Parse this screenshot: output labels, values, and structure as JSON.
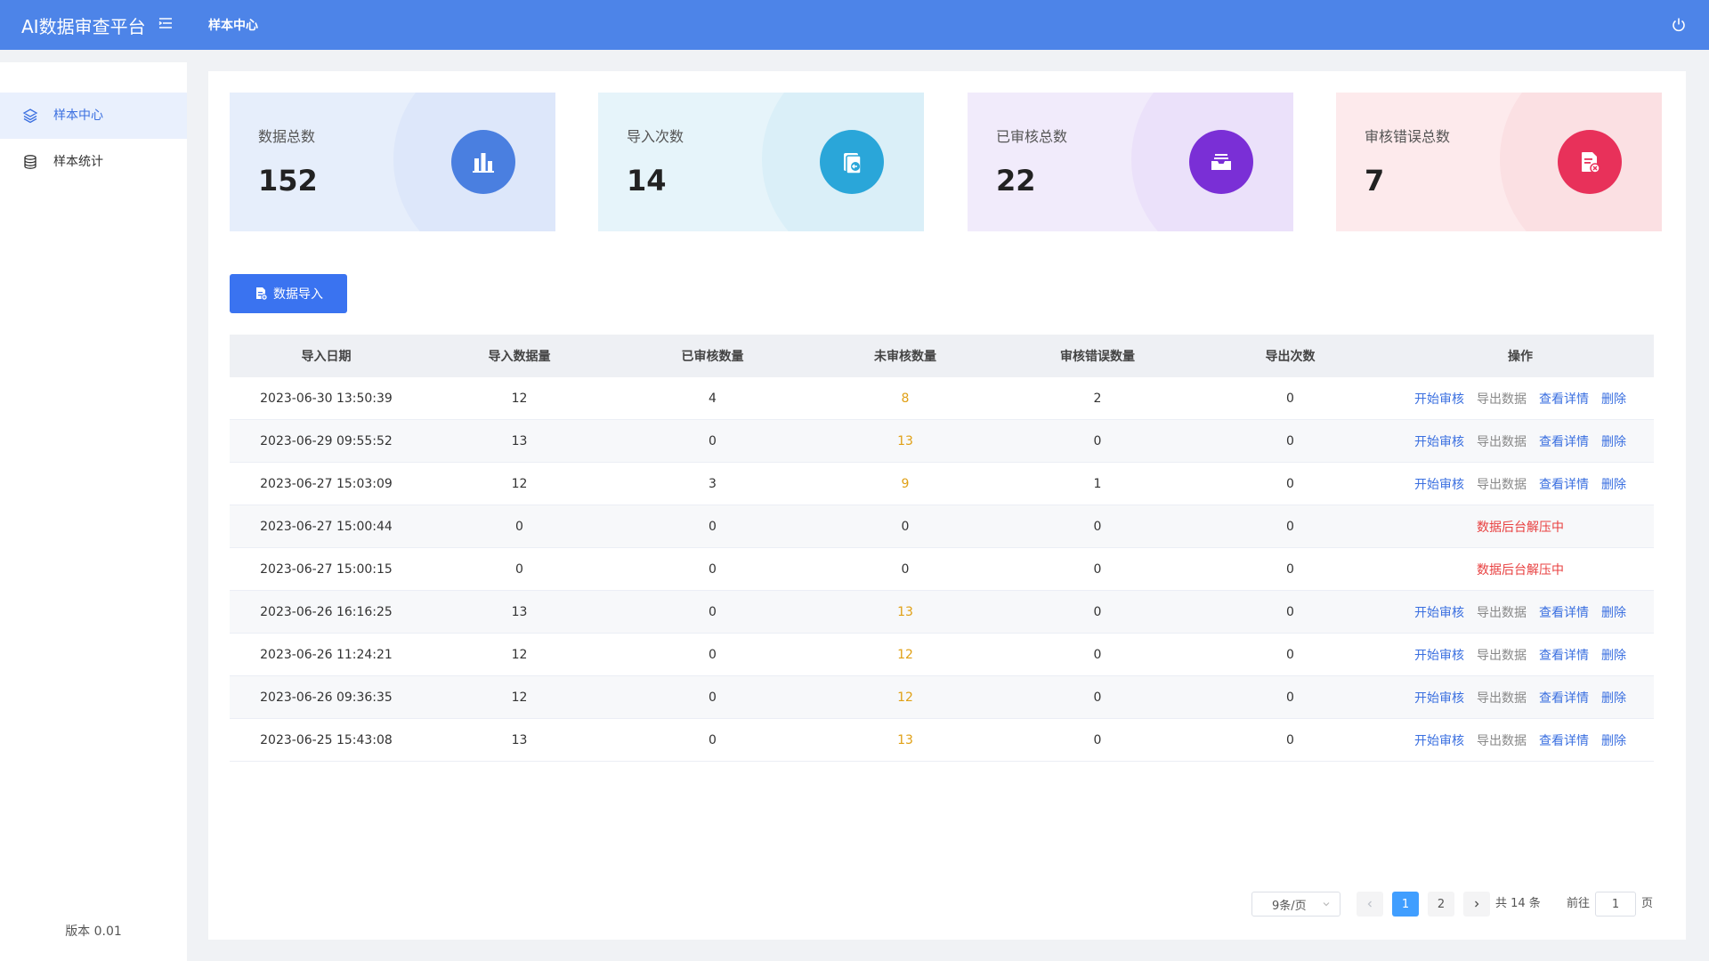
{
  "header": {
    "brand": "AI数据审查平台",
    "title": "样本中心"
  },
  "sidebar": {
    "items": [
      {
        "label": "样本中心",
        "icon": "layers-icon",
        "active": true
      },
      {
        "label": "样本统计",
        "icon": "database-icon",
        "active": false
      }
    ],
    "version": "版本  0.01"
  },
  "stats": [
    {
      "label": "数据总数",
      "value": "152",
      "bg": "#e6eefb",
      "circle_bg": "#dde7fa",
      "icon_bg": "#4a7fe0",
      "icon": "bar-chart-icon"
    },
    {
      "label": "导入次数",
      "value": "14",
      "bg": "#e6f4fa",
      "circle_bg": "#daeff8",
      "icon_bg": "#2aa6d9",
      "icon": "import-doc-icon"
    },
    {
      "label": "已审核总数",
      "value": "22",
      "bg": "#f1ebfb",
      "circle_bg": "#ebe1fa",
      "icon_bg": "#7a2fd6",
      "icon": "inbox-icon"
    },
    {
      "label": "审核错误总数",
      "value": "7",
      "bg": "#fdeaec",
      "circle_bg": "#fbe0e3",
      "icon_bg": "#e8315a",
      "icon": "doc-error-icon"
    }
  ],
  "import_button": "数据导入",
  "table": {
    "headers": [
      "导入日期",
      "导入数据量",
      "已审核数量",
      "未审核数量",
      "审核错误数量",
      "导出次数",
      "操作"
    ],
    "rows": [
      {
        "date": "2023-06-30 13:50:39",
        "count": "12",
        "reviewed": "4",
        "pending": "8",
        "errors": "2",
        "exports": "0",
        "status": ""
      },
      {
        "date": "2023-06-29 09:55:52",
        "count": "13",
        "reviewed": "0",
        "pending": "13",
        "errors": "0",
        "exports": "0",
        "status": ""
      },
      {
        "date": "2023-06-27 15:03:09",
        "count": "12",
        "reviewed": "3",
        "pending": "9",
        "errors": "1",
        "exports": "0",
        "status": ""
      },
      {
        "date": "2023-06-27 15:00:44",
        "count": "0",
        "reviewed": "0",
        "pending": "0",
        "errors": "0",
        "exports": "0",
        "status": "数据后台解压中"
      },
      {
        "date": "2023-06-27 15:00:15",
        "count": "0",
        "reviewed": "0",
        "pending": "0",
        "errors": "0",
        "exports": "0",
        "status": "数据后台解压中"
      },
      {
        "date": "2023-06-26 16:16:25",
        "count": "13",
        "reviewed": "0",
        "pending": "13",
        "errors": "0",
        "exports": "0",
        "status": ""
      },
      {
        "date": "2023-06-26 11:24:21",
        "count": "12",
        "reviewed": "0",
        "pending": "12",
        "errors": "0",
        "exports": "0",
        "status": ""
      },
      {
        "date": "2023-06-26 09:36:35",
        "count": "12",
        "reviewed": "0",
        "pending": "12",
        "errors": "0",
        "exports": "0",
        "status": ""
      },
      {
        "date": "2023-06-25 15:43:08",
        "count": "13",
        "reviewed": "0",
        "pending": "13",
        "errors": "0",
        "exports": "0",
        "status": ""
      }
    ],
    "actions": {
      "start": "开始审核",
      "export": "导出数据",
      "view": "查看详情",
      "delete": "删除"
    }
  },
  "pagination": {
    "page_size": "9条/页",
    "pages": [
      "1",
      "2"
    ],
    "current": "1",
    "total": "共 14 条",
    "goto_label": "前往",
    "goto_value": "1",
    "goto_unit": "页"
  },
  "colors": {
    "topbar": "#4d84e8",
    "primary": "#3a73f0",
    "pending": "#e0a015",
    "status_red": "#e84040"
  }
}
